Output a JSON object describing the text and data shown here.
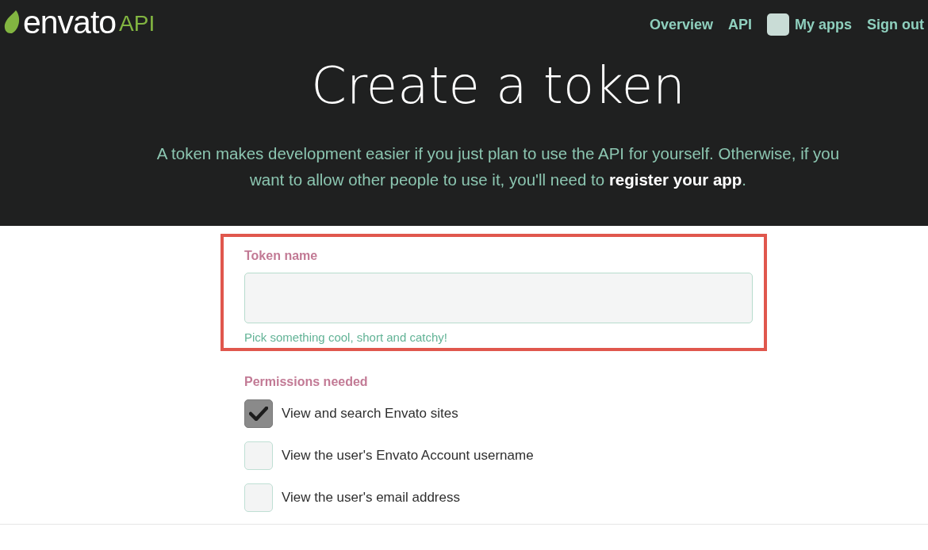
{
  "header": {
    "logo": {
      "brand": "envato",
      "product": "API"
    },
    "nav": [
      {
        "label": "Overview",
        "kind": "link"
      },
      {
        "label": "API",
        "kind": "link"
      },
      {
        "label": "My apps",
        "kind": "account"
      },
      {
        "label": "Sign out",
        "kind": "link"
      }
    ],
    "title": "Create a token",
    "intro": {
      "text": "A token makes development easier if you just plan to use the API for yourself. Otherwise, if you want to allow other people to use it, you'll need to",
      "link": "register your app",
      "tail": "."
    }
  },
  "token_field": {
    "label": "Token name",
    "hint": "Pick something cool, short and catchy!",
    "highlighted": true
  },
  "permissions": {
    "heading": "Permissions needed",
    "items": [
      {
        "label": "View and search Envato sites",
        "checked": true
      },
      {
        "label": "View the user's Envato Account username",
        "checked": false
      },
      {
        "label": "View the user's email address",
        "checked": false
      }
    ]
  }
}
